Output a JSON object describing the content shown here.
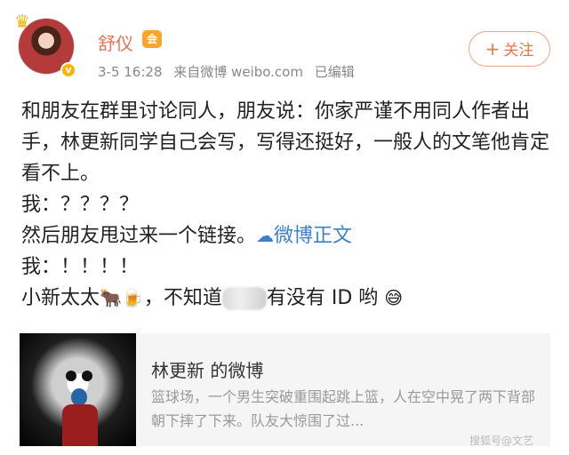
{
  "post": {
    "username": "舒仪",
    "vip_badge": "会",
    "verified_badge": "v",
    "timestamp": "3-5 16:28",
    "source": "来自微博 weibo.com",
    "edited": "已编辑",
    "follow_label": "关注",
    "follow_plus": "+"
  },
  "content": {
    "line1": "和朋友在群里讨论同人，朋友说：你家严谨不用同人作者出手，林更新同学自己会写，写得还挺好，一般人的文笔他肯定看不上。",
    "line2": "我：？？？？",
    "line3_text": "然后朋友甩过来一个链接。",
    "line3_link": "微博正文",
    "line4": "我：！！！！",
    "line5_a": "小新太太",
    "line5_b": "，不知道",
    "line5_c": "有没有 ID 哟"
  },
  "card": {
    "title": "林更新 的微博",
    "desc": "篮球场，一个男生突破重围起跳上篮，人在空中晃了两下背部朝下摔了下来。队友大惊围了过..."
  },
  "watermark": "搜狐号@文艺",
  "colors": {
    "username": "#eb7350",
    "link": "#3d82c8",
    "meta": "#888888",
    "card_bg": "#f5f5f5"
  },
  "icons": {
    "crown": "crown-icon",
    "vip": "vip-member-icon",
    "verified": "verified-v-icon",
    "link": "link-icon",
    "cow": "cow-emoji-icon",
    "beer": "beer-emoji-icon",
    "sweat": "sweat-smile-emoji-icon"
  }
}
